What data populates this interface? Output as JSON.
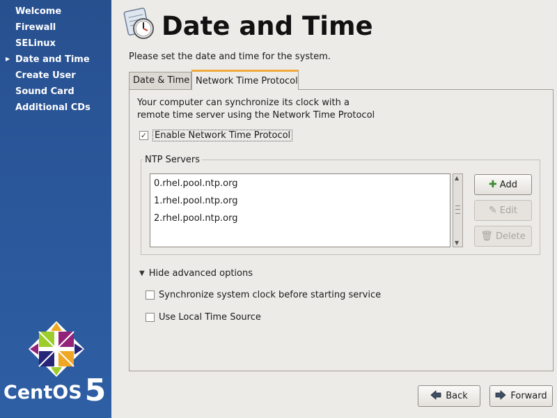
{
  "sidebar": {
    "items": [
      {
        "label": "Welcome",
        "current": false
      },
      {
        "label": "Firewall",
        "current": false
      },
      {
        "label": "SELinux",
        "current": false
      },
      {
        "label": "Date and Time",
        "current": true
      },
      {
        "label": "Create User",
        "current": false
      },
      {
        "label": "Sound Card",
        "current": false
      },
      {
        "label": "Additional CDs",
        "current": false
      }
    ],
    "brand_word": "CentOS",
    "brand_version": "5"
  },
  "header": {
    "title": "Date and Time",
    "subtitle": "Please set the date and time for the system."
  },
  "tabs": [
    {
      "label": "Date & Time",
      "active": false
    },
    {
      "label": "Network Time Protocol",
      "active": true
    }
  ],
  "ntp": {
    "description_line1": "Your computer can synchronize its clock with a",
    "description_line2": "remote time server using the Network Time Protocol",
    "enable_label": "Enable Network Time Protocol",
    "enable_checked": true,
    "servers_legend": "NTP Servers",
    "servers": [
      "0.rhel.pool.ntp.org",
      "1.rhel.pool.ntp.org",
      "2.rhel.pool.ntp.org"
    ],
    "add_label": "Add",
    "edit_label": "Edit",
    "delete_label": "Delete",
    "advanced_toggle_label": "Hide advanced options",
    "sync_label": "Synchronize system clock before starting service",
    "sync_checked": false,
    "local_source_label": "Use Local Time Source",
    "local_source_checked": false
  },
  "footer": {
    "back_label": "Back",
    "forward_label": "Forward"
  },
  "colors": {
    "sidebar_bg": "#2a5699",
    "tab_accent": "#f0a93a",
    "add_icon": "#3a8a2e"
  }
}
